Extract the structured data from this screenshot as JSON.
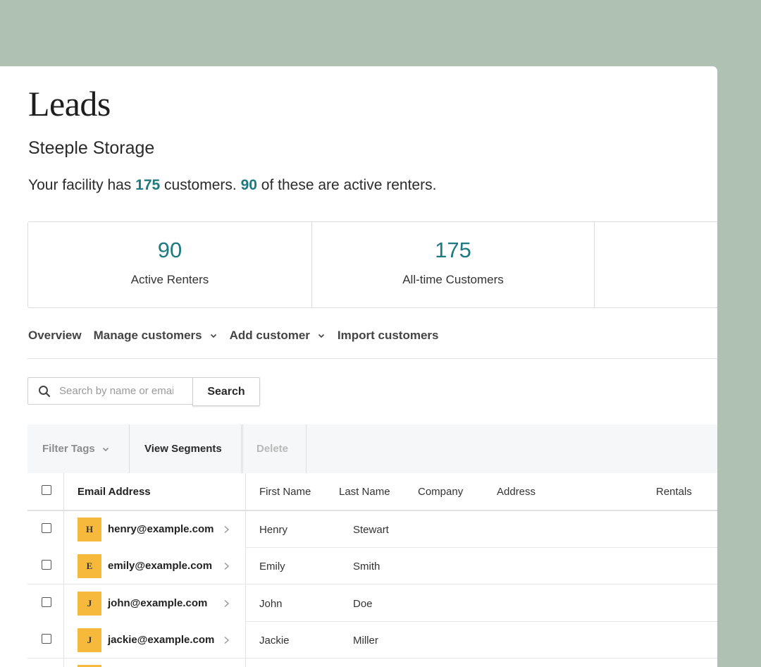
{
  "page": {
    "title": "Leads",
    "facility_name": "Steeple Storage",
    "summary": {
      "prefix": "Your facility has",
      "customers_count": "175",
      "middle": "customers.",
      "active_count": "90",
      "suffix": "of these are active renters."
    }
  },
  "stats": [
    {
      "value": "90",
      "label": "Active Renters"
    },
    {
      "value": "175",
      "label": "All-time Customers"
    }
  ],
  "nav": {
    "overview": "Overview",
    "manage_customers": "Manage customers",
    "add_customer": "Add customer",
    "import_customers": "Import customers"
  },
  "search": {
    "placeholder": "Search by name or email",
    "button_label": "Search"
  },
  "toolbar": {
    "filter_tags": "Filter Tags",
    "view_segments": "View Segments",
    "delete": "Delete"
  },
  "table": {
    "headers": {
      "email": "Email Address",
      "first_name": "First Name",
      "last_name": "Last Name",
      "company": "Company",
      "address": "Address",
      "rentals": "Rentals"
    },
    "rows": [
      {
        "initial": "H",
        "email": "henry@example.com",
        "first_name": "Henry",
        "last_name": "Stewart"
      },
      {
        "initial": "E",
        "email": "emily@example.com",
        "first_name": "Emily",
        "last_name": "Smith"
      },
      {
        "initial": "J",
        "email": "john@example.com",
        "first_name": "John",
        "last_name": "Doe"
      },
      {
        "initial": "J",
        "email": "jackie@example.com",
        "first_name": "Jackie",
        "last_name": "Miller"
      }
    ]
  },
  "colors": {
    "accent": "#1c7a80",
    "avatar": "#f6b93b",
    "background": "#afc1b3"
  }
}
